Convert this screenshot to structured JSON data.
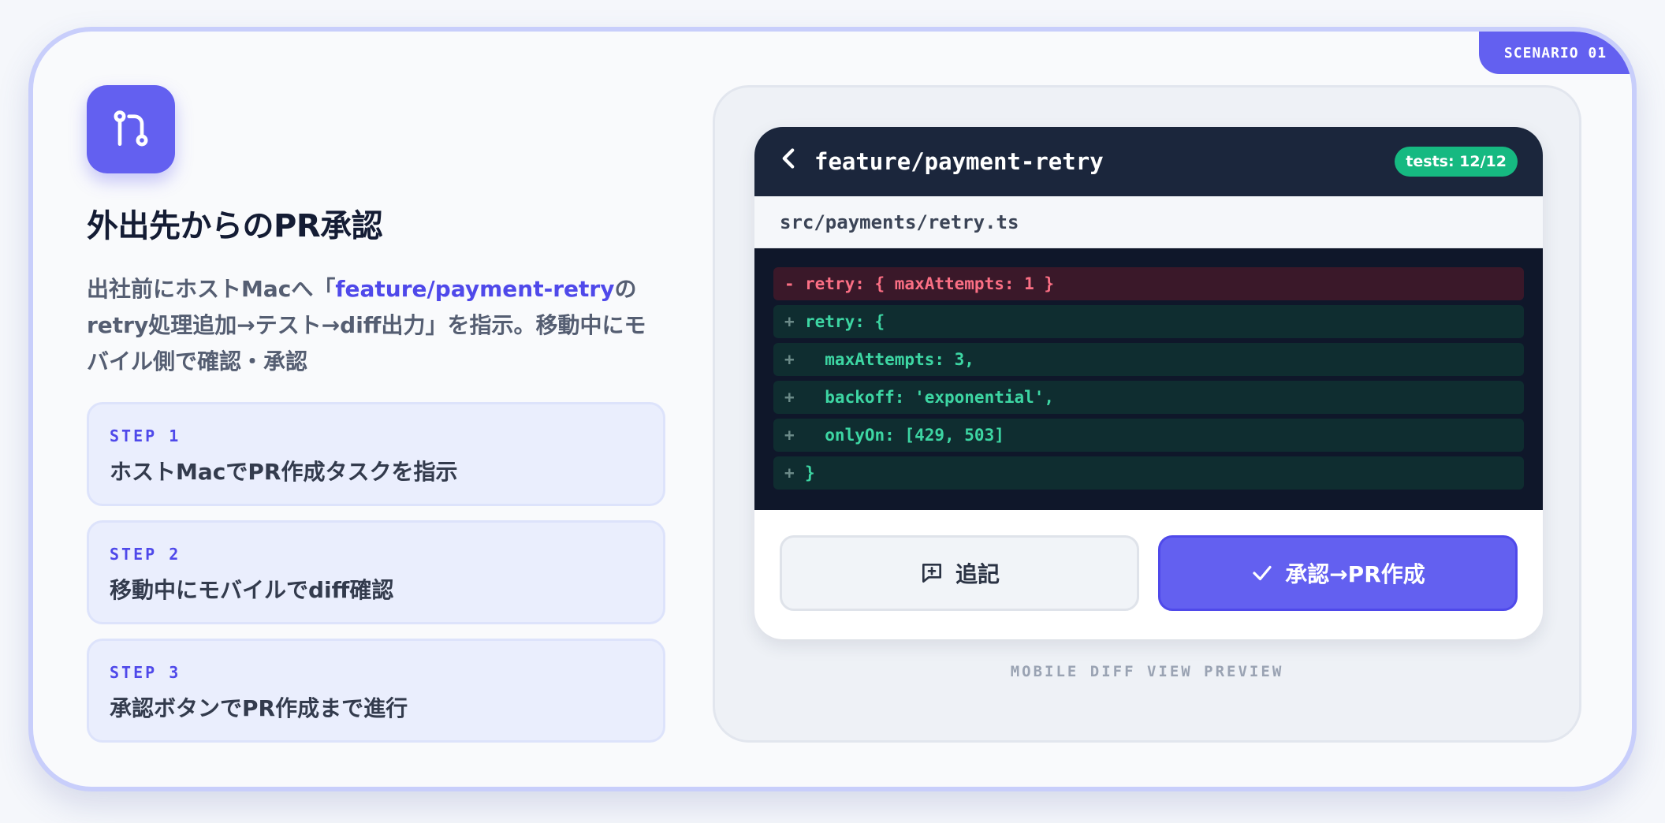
{
  "badge": "SCENARIO 01",
  "app_icon": "git-pull-request-icon",
  "title": "外出先からのPR承認",
  "description": {
    "before": "出社前にホストMacへ「",
    "highlight": "feature/payment-retry",
    "after": "のretry処理追加→テスト→diff出力」を指示。移動中にモバイル側で確認・承認"
  },
  "steps": [
    {
      "label": "STEP 1",
      "text": "ホストMacでPR作成タスクを指示"
    },
    {
      "label": "STEP 2",
      "text": "移動中にモバイルでdiff確認"
    },
    {
      "label": "STEP 3",
      "text": "承認ボタンでPR作成まで進行"
    }
  ],
  "preview": {
    "back_icon": "chevron-left-icon",
    "branch": "feature/payment-retry",
    "tests": "tests: 12/12",
    "file_path": "src/payments/retry.ts",
    "diff": [
      {
        "marker": "-",
        "code": "retry: { maxAttempts: 1 }"
      },
      {
        "marker": "+",
        "code": "retry: {"
      },
      {
        "marker": "+",
        "code": "  maxAttempts: 3,"
      },
      {
        "marker": "+",
        "code": "  backoff: 'exponential',"
      },
      {
        "marker": "+",
        "code": "  onlyOn: [429, 503]"
      },
      {
        "marker": "+",
        "code": "}"
      }
    ],
    "comment_button": "追記",
    "approve_button": "承認→PR作成",
    "caption": "MOBILE DIFF VIEW PREVIEW"
  },
  "colors": {
    "accent": "#6360f0",
    "success": "#16b981",
    "deletion": "#fb6f84",
    "addition": "#3dd6a3",
    "header_bg": "#1b263c"
  }
}
